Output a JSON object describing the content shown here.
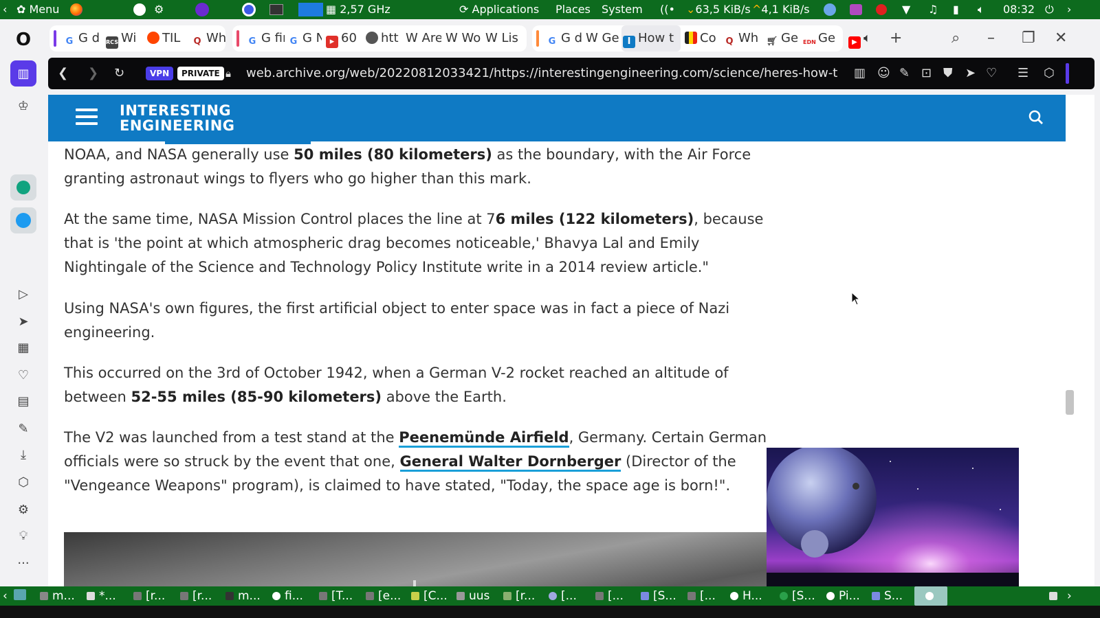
{
  "system_panel": {
    "menu_label": "Menu",
    "cpu_freq": "2,57 GHz",
    "applications": "Applications",
    "places": "Places",
    "system": "System",
    "net_down": "63,5 KiB/s",
    "net_up": "4,1 KiB/s",
    "clock": "08:32",
    "colors": {
      "panel": "#0d6b1e"
    }
  },
  "browser": {
    "tabs": [
      {
        "label": "G did",
        "favicon": "G"
      },
      {
        "label": "Wi",
        "favicon": "RCS"
      },
      {
        "label": "TIL",
        "favicon": "reddit"
      },
      {
        "label": "Wh",
        "favicon": "Q"
      },
      {
        "label": "G firs",
        "favicon": "G"
      },
      {
        "label": "G No",
        "favicon": "G"
      },
      {
        "label": "60",
        "favicon": "flag"
      },
      {
        "label": "htt",
        "favicon": "globe"
      },
      {
        "label": "W Are",
        "favicon": "W"
      },
      {
        "label": "W Wo",
        "favicon": "W"
      },
      {
        "label": "W Lis",
        "favicon": "W"
      },
      {
        "label": "G did",
        "favicon": "G"
      },
      {
        "label": "W Ge",
        "favicon": "W"
      },
      {
        "label": "How t",
        "favicon": "IE"
      },
      {
        "label": "Co",
        "favicon": "flag"
      },
      {
        "label": "Wh",
        "favicon": "Q"
      },
      {
        "label": "Ge",
        "favicon": "cart"
      },
      {
        "label": "Ge",
        "favicon": "EDN"
      }
    ],
    "vpn_badge": "VPN",
    "private_badge": "PRIVATE",
    "url": "web.archive.org/web/20220812033421/https://interestingengineering.com/science/heres-how-t",
    "accent_colors": {
      "vpn": "#4a3de8",
      "header": "#0f7ac4",
      "link_underline": "#1a9fd8"
    }
  },
  "site": {
    "logo_line1": "INTERESTING",
    "logo_line2": "ENGINEERING"
  },
  "article": {
    "p1": {
      "a": "NOAA, and NASA generally use ",
      "b": "50 miles (80 kilometers)",
      "c": " as the boundary, with the Air Force granting astronaut wings to flyers who go higher than this mark."
    },
    "p2": {
      "a": "At the same time, NASA Mission Control places the line at 7",
      "b": "6 miles (122 kilometers)",
      "c": ", because that is 'the point at which atmospheric drag becomes noticeable,' Bhavya Lal and Emily Nightingale of the Science and Technology Policy Institute write in a 2014 review article.\""
    },
    "p3": "Using NASA's own figures, the first artificial object to enter space was in fact a piece of Nazi engineering.",
    "p4": {
      "a": "This occurred on the 3rd of October 1942, when a German V-2 rocket reached an altitude of between ",
      "b": "52-55 miles (85-90 kilometers)",
      "c": " above the Earth."
    },
    "p5": {
      "a": "The V2 was launched from a test stand at the ",
      "link1": "Peenemünde Airfield",
      "b": ", Germany. Certain German officials were so struck by the event that one, ",
      "link2": "General Walter Dornberger",
      "c": " (Director of the \"Vengeance Weapons\" program), is claimed to have stated, \"Today, the space age is born!\"."
    }
  },
  "taskbar": {
    "items": [
      "m...",
      "*...",
      "[r...",
      "[r...",
      "m...",
      "fi...",
      "[T...",
      "[e...",
      "[C...",
      "uus",
      "[r...",
      "[...",
      "[...",
      "[S...",
      "[...",
      "H...",
      "[S...",
      "Pi...",
      "S..."
    ]
  }
}
